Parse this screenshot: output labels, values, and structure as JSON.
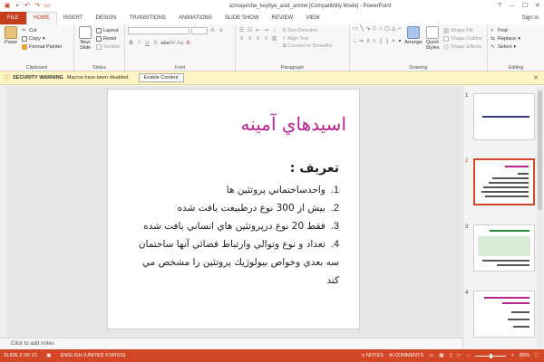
{
  "window": {
    "title": "azmayeshe_keyfiye_asid_amine [Compatibility Mode] - PowerPoint",
    "controls": [
      "?",
      "–",
      "☐",
      "✕"
    ]
  },
  "tabs": [
    "FILE",
    "HOME",
    "INSERT",
    "DESIGN",
    "TRANSITIONS",
    "ANIMATIONS",
    "SLIDE SHOW",
    "REVIEW",
    "VIEW"
  ],
  "sign_in": "Sign in",
  "ribbon": {
    "clipboard": {
      "label": "Clipboard",
      "paste": "Paste",
      "cut": "Cut",
      "copy": "Copy",
      "format_painter": "Format Painter"
    },
    "slides": {
      "label": "Slides",
      "new_slide": "New Slide",
      "layout": "Layout",
      "reset": "Reset",
      "section": "Section"
    },
    "font": {
      "label": "Font"
    },
    "paragraph": {
      "label": "Paragraph",
      "text_direction": "Text Direction",
      "align_text": "Align Text",
      "convert": "Convert to SmartArt"
    },
    "drawing": {
      "label": "Drawing",
      "arrange": "Arrange",
      "quick_styles": "Quick Styles",
      "shape_fill": "Shape Fill",
      "shape_outline": "Shape Outline",
      "shape_effects": "Shape Effects"
    },
    "editing": {
      "label": "Editing",
      "find": "Find",
      "replace": "Replace",
      "select": "Select"
    }
  },
  "security_bar": {
    "label": "SECURITY WARNING",
    "message": "Macros have been disabled.",
    "button": "Enable Content"
  },
  "slide": {
    "title": "اسيدهاي آمينه",
    "subtitle": "تعريف :",
    "bullets": [
      {
        "num": "1.",
        "text": "واحدساختماني پروتئين ها"
      },
      {
        "num": "2.",
        "text": "بيش از 300 نوع درطبيعت يافت شده"
      },
      {
        "num": "3.",
        "text": "فقط 20 نوع درپروتئين هاي انساني يافت شده"
      },
      {
        "num": "4.",
        "text": "تعداد و نوع وتوالي وارتباط فضائي آنها ساختمان سه بعدي وخواص بيولوژيك پروتئين را مشخص مي كند"
      }
    ]
  },
  "notes_placeholder": "Click to add notes",
  "thumbnails": [
    {
      "num": "1",
      "selected": false
    },
    {
      "num": "2",
      "selected": true
    },
    {
      "num": "3",
      "selected": false
    },
    {
      "num": "4",
      "selected": false
    }
  ],
  "status": {
    "slide": "SLIDE 2 OF 21",
    "language": "ENGLISH (UNITED STATES)",
    "notes": "NOTES",
    "comments": "COMMENTS",
    "zoom": "66%"
  },
  "colors": {
    "accent": "#d24726",
    "title_magenta": "#b7238f",
    "security_yellow": "#fff4c3"
  }
}
